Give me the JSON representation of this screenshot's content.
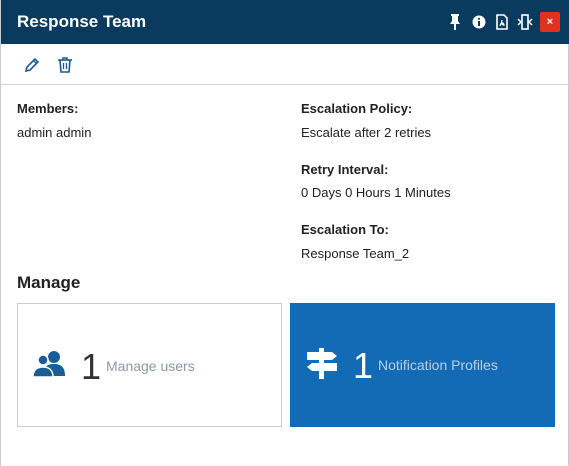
{
  "window": {
    "title": "Response Team",
    "buttons": [
      "pin-icon",
      "info-icon",
      "pdf-icon",
      "resize-icon",
      "close-icon"
    ],
    "close_label": "×"
  },
  "toolbar": {
    "icons": [
      "edit-icon",
      "delete-icon"
    ]
  },
  "details": {
    "members_label": "Members:",
    "members_value": "admin admin",
    "escalation_policy_label": "Escalation Policy:",
    "escalation_policy_value": "Escalate after 2 retries",
    "retry_interval_label": "Retry Interval:",
    "retry_interval_value": "0 Days 0 Hours 1 Minutes",
    "escalation_to_label": "Escalation To:",
    "escalation_to_value": "Response Team_2"
  },
  "manage": {
    "title": "Manage",
    "cards": [
      {
        "icon": "users-icon",
        "count": "1",
        "label": "Manage users"
      },
      {
        "icon": "signpost-icon",
        "count": "1",
        "label": "Notification Profiles"
      }
    ]
  },
  "colors": {
    "header": "#0a3b5f",
    "close": "#e0321e",
    "accent": "#146bb5",
    "icon": "#1a5c96"
  }
}
